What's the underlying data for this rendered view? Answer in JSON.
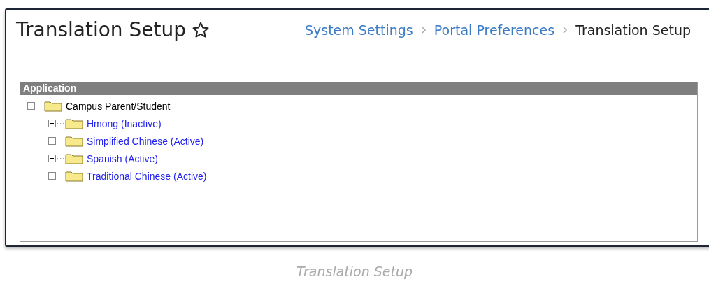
{
  "page": {
    "title": "Translation Setup"
  },
  "breadcrumbs": [
    {
      "label": "System Settings",
      "current": false
    },
    {
      "label": "Portal Preferences",
      "current": false
    },
    {
      "label": "Translation Setup",
      "current": true
    }
  ],
  "tree": {
    "header": "Application",
    "items": [
      {
        "label": "Campus Parent/Student",
        "expanded": true,
        "link": false,
        "children": [
          {
            "label": "Hmong (Inactive)",
            "expanded": false,
            "link": true
          },
          {
            "label": "Simplified Chinese (Active)",
            "expanded": false,
            "link": true
          },
          {
            "label": "Spanish (Active)",
            "expanded": false,
            "link": true
          },
          {
            "label": "Traditional Chinese (Active)",
            "expanded": false,
            "link": true
          }
        ]
      }
    ]
  },
  "caption": "Translation Setup"
}
